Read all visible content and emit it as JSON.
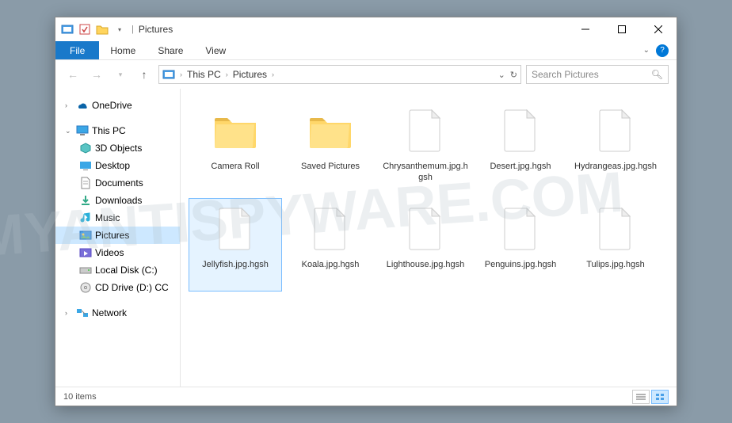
{
  "window": {
    "title": "Pictures"
  },
  "ribbon": {
    "file": "File",
    "tabs": [
      "Home",
      "Share",
      "View"
    ]
  },
  "breadcrumb": [
    "This PC",
    "Pictures"
  ],
  "search": {
    "placeholder": "Search Pictures"
  },
  "sidebar": {
    "onedrive": "OneDrive",
    "thispc": "This PC",
    "items": [
      {
        "label": "3D Objects"
      },
      {
        "label": "Desktop"
      },
      {
        "label": "Documents"
      },
      {
        "label": "Downloads"
      },
      {
        "label": "Music"
      },
      {
        "label": "Pictures",
        "selected": true
      },
      {
        "label": "Videos"
      },
      {
        "label": "Local Disk (C:)"
      },
      {
        "label": "CD Drive (D:) CC"
      }
    ],
    "network": "Network"
  },
  "items": [
    {
      "label": "Camera Roll",
      "type": "folder"
    },
    {
      "label": "Saved Pictures",
      "type": "folder"
    },
    {
      "label": "Chrysanthemum.jpg.hgsh",
      "type": "file"
    },
    {
      "label": "Desert.jpg.hgsh",
      "type": "file"
    },
    {
      "label": "Hydrangeas.jpg.hgsh",
      "type": "file"
    },
    {
      "label": "Jellyfish.jpg.hgsh",
      "type": "file",
      "selected": true
    },
    {
      "label": "Koala.jpg.hgsh",
      "type": "file"
    },
    {
      "label": "Lighthouse.jpg.hgsh",
      "type": "file"
    },
    {
      "label": "Penguins.jpg.hgsh",
      "type": "file"
    },
    {
      "label": "Tulips.jpg.hgsh",
      "type": "file"
    }
  ],
  "status": {
    "count": "10 items"
  },
  "watermark": "MYANTISPYWARE.COM"
}
